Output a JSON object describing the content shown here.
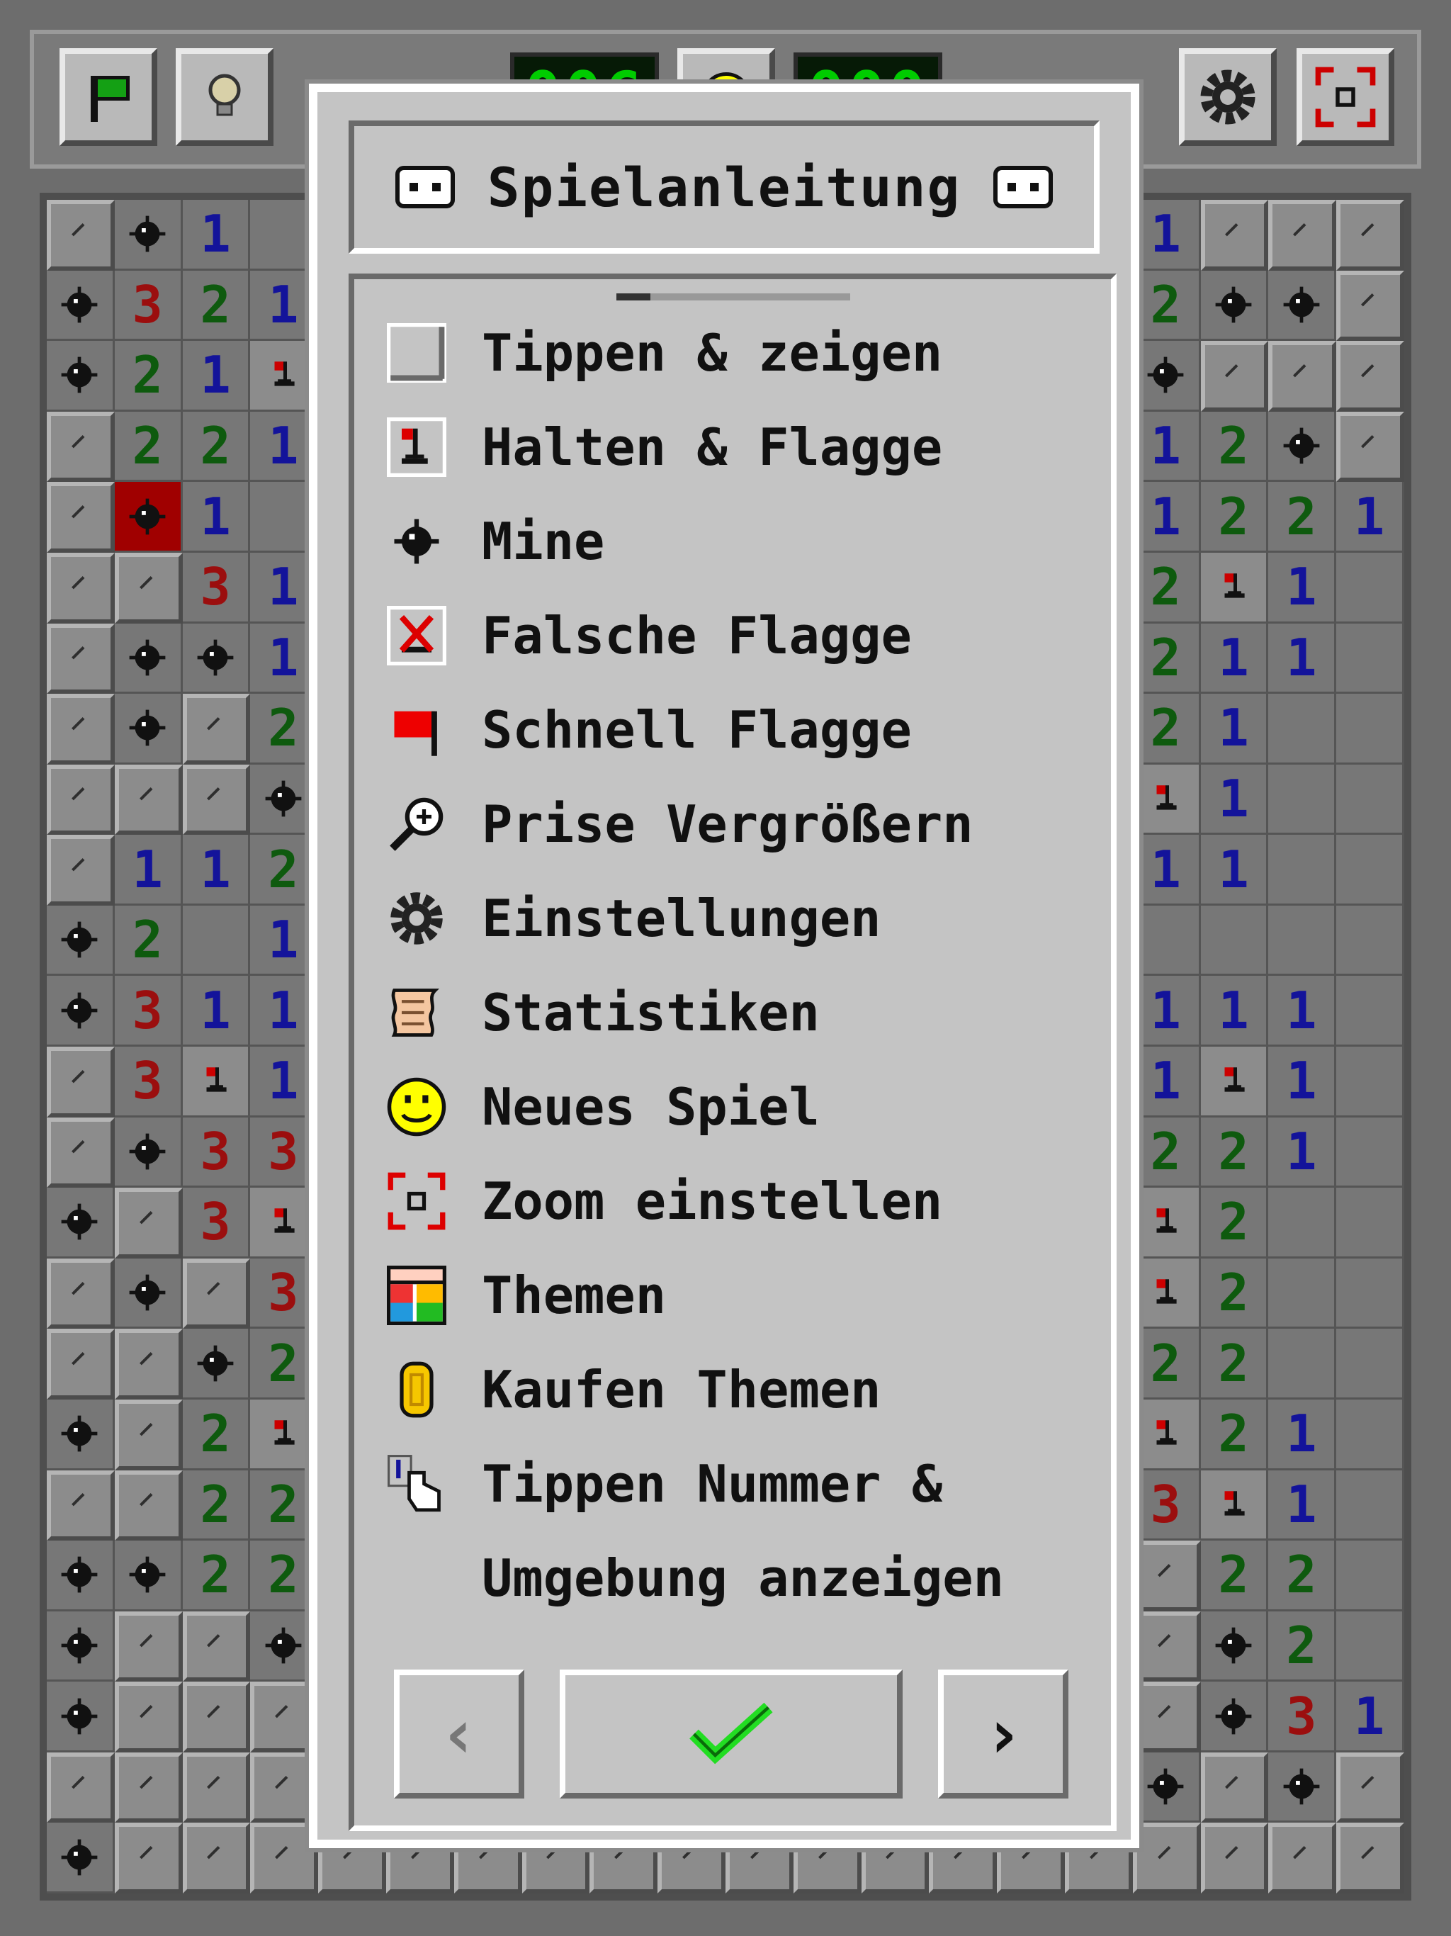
{
  "toolbar": {
    "flag_icon": "flag-icon",
    "hint_icon": "lightbulb-icon",
    "mines_left": "006",
    "timer": "000",
    "settings_icon": "gear-icon",
    "zoom_icon": "zoom-icon"
  },
  "dialog": {
    "title": "Spielanleitung",
    "items": [
      {
        "icon": "closed-cell-icon",
        "label": "Tippen & zeigen"
      },
      {
        "icon": "flagged-cell-icon",
        "label": "Halten & Flagge"
      },
      {
        "icon": "mine-icon",
        "label": "Mine"
      },
      {
        "icon": "wrong-flag-icon",
        "label": "Falsche Flagge"
      },
      {
        "icon": "quick-flag-icon",
        "label": "Schnell Flagge"
      },
      {
        "icon": "magnifier-icon",
        "label": "Prise Vergrößern"
      },
      {
        "icon": "gear-icon",
        "label": "Einstellungen"
      },
      {
        "icon": "scroll-icon",
        "label": "Statistiken"
      },
      {
        "icon": "smiley-icon",
        "label": "Neues Spiel"
      },
      {
        "icon": "zoom-icon",
        "label": "Zoom einstellen"
      },
      {
        "icon": "themes-icon",
        "label": "Themen"
      },
      {
        "icon": "coin-icon",
        "label": "Kaufen Themen"
      },
      {
        "icon": "tap-number-icon",
        "label": "Tippen Nummer &"
      },
      {
        "icon": "",
        "label": "Umgebung anzeigen"
      }
    ],
    "prev_label": "‹",
    "ok_label": "✓",
    "next_label": "›"
  },
  "board": {
    "rows": [
      "c*1..........1ccc",
      "*321.........2**c",
      "*21f.........*ccc",
      "c221.........12*c",
      "cX1..........1221",
      "cc31.........2f1.",
      "c**1.........211.",
      "c*c2.........21..",
      "cccm.........f1..",
      "c112.........11..",
      "*2.1.............",
      "*311.........111.",
      "c3f1.........1f1.",
      "c*33.........221.",
      "*c3f.........f2..",
      "c*c3.........f2..",
      "cc*2.........22..",
      "*c2f.........f21.",
      "cc22.........3f1.",
      "**22.........c22.",
      "*ccm.........c*2.",
      "*ccc.........c*31",
      "cccc.........*c*c",
      "*ccc.........cccc"
    ]
  }
}
